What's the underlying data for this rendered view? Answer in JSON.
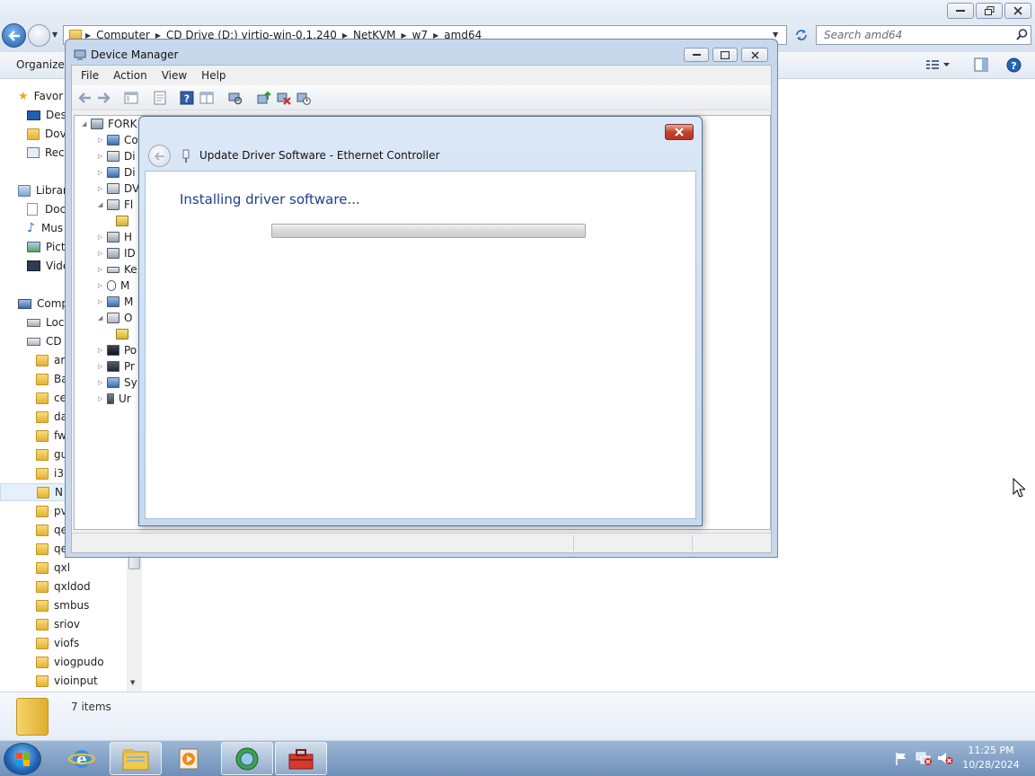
{
  "explorer": {
    "breadcrumbs": [
      "Computer",
      "CD Drive (D:) virtio-win-0.1.240",
      "NetKVM",
      "w7",
      "amd64"
    ],
    "search_placeholder": "Search amd64",
    "organize_label": "Organize",
    "nav_items": [
      {
        "label": "Favor",
        "icon": "star-icon"
      },
      {
        "label": "Des",
        "icon": "desktop-icon"
      },
      {
        "label": "Dov",
        "icon": "downloads-icon"
      },
      {
        "label": "Rec",
        "icon": "recent-places-icon"
      },
      {
        "label": "Librar",
        "icon": "libraries-icon"
      },
      {
        "label": "Doc",
        "icon": "documents-icon"
      },
      {
        "label": "Mus",
        "icon": "music-icon"
      },
      {
        "label": "Pict",
        "icon": "pictures-icon"
      },
      {
        "label": "Vide",
        "icon": "videos-icon"
      },
      {
        "label": "Comp",
        "icon": "computer-icon"
      },
      {
        "label": "Loc",
        "icon": "drive-icon"
      },
      {
        "label": "CD",
        "icon": "cd-drive-icon"
      }
    ],
    "folders": [
      "ar",
      "Ba",
      "ce",
      "da",
      "fw",
      "gu",
      "i3",
      "N",
      "pv",
      "qe",
      "qe",
      "qxl",
      "qxldod",
      "smbus",
      "sriov",
      "viofs",
      "viogpudo",
      "vioinput"
    ],
    "selected_folder_index": 7,
    "status_items": "7 items"
  },
  "device_manager": {
    "title": "Device Manager",
    "menu": [
      "File",
      "Action",
      "View",
      "Help"
    ],
    "tree_root": "FORK",
    "tree_nodes": [
      "Co",
      "Di",
      "Di",
      "DV",
      "Fl",
      "",
      "H",
      "ID",
      "Ke",
      "M",
      "M",
      "O",
      "",
      "Po",
      "Pr",
      "Sy",
      "Ur"
    ]
  },
  "dialog": {
    "title": "Update Driver Software - Ethernet Controller",
    "heading": "Installing driver software...",
    "progress": 0.0
  },
  "taskbar": {
    "time": "11:25 PM",
    "date": "10/28/2024"
  }
}
